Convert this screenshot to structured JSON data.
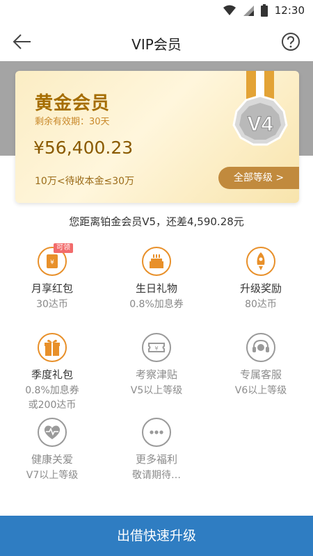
{
  "status_bar": {
    "time": "12:30"
  },
  "header": {
    "title": "VIP会员"
  },
  "card": {
    "level_name": "黄金会员",
    "validity": "剩余有效期：30天",
    "amount": "¥56,400.23",
    "range": "10万<待收本金≤30万",
    "all_levels_label": "全部等级 >",
    "badge_text": "V4"
  },
  "gap_text": "您距离铂金会员V5，还差4,590.28元",
  "benefits": [
    {
      "name": "月享红包",
      "sub": "30达币",
      "tag": "可领",
      "icon": "red-envelope-icon",
      "locked": false
    },
    {
      "name": "生日礼物",
      "sub": "0.8%加息券",
      "icon": "cake-icon",
      "locked": false
    },
    {
      "name": "升级奖励",
      "sub": "80达币",
      "icon": "rocket-icon",
      "locked": false
    },
    {
      "name": "季度礼包",
      "sub": "0.8%加息券",
      "sub2": "或200达币",
      "icon": "gift-icon",
      "locked": false
    },
    {
      "name": "考察津贴",
      "sub": "V5以上等级",
      "icon": "ticket-icon",
      "locked": true
    },
    {
      "name": "专属客服",
      "sub": "V6以上等级",
      "icon": "headset-icon",
      "locked": true
    },
    {
      "name": "健康关爱",
      "sub": "V7以上等级",
      "icon": "heart-monitor-icon",
      "locked": true
    },
    {
      "name": "更多福利",
      "sub": "敬请期待…",
      "icon": "more-dots-icon",
      "locked": true
    }
  ],
  "cta": {
    "label": "出借快速升级"
  },
  "colors": {
    "accent_gold": "#c18a3d",
    "benefit_orange": "#e8902a",
    "locked_gray": "#9a9a9a",
    "cta_blue": "#2f7dc2"
  }
}
